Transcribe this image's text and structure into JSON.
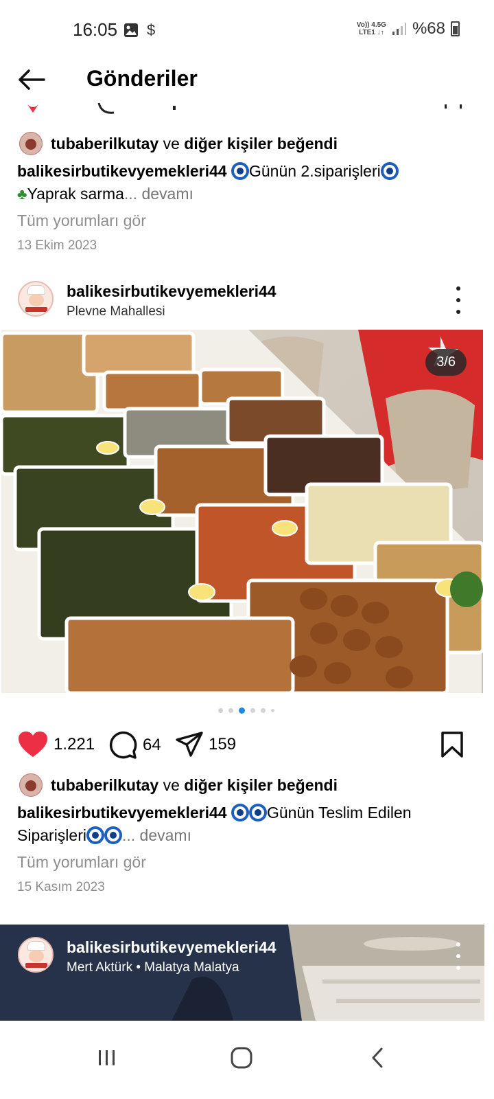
{
  "status": {
    "time": "16:05",
    "left_icons": [
      "image-icon",
      "dollar-icon"
    ],
    "net_top": "Vo)) 4.5G",
    "net_bottom": "LTE1 ↓↑",
    "battery": "%68"
  },
  "header": {
    "title": "Gönderiler",
    "back_icon": "arrow-left-icon"
  },
  "previous_post": {
    "liked_user": "tubaberilkutay",
    "liked_connector": "ve",
    "liked_others": "diğer kişiler beğendi",
    "caption_user": "balikesirbutikevyemekleri44",
    "caption_text": "Günün 2.siparişleri",
    "caption_line2": "Yaprak sarma",
    "more_label": "... devamı",
    "comments_link": "Tüm yorumları gör",
    "date": "13 Ekim 2023"
  },
  "post": {
    "username": "balikesirbutikevyemekleri44",
    "location": "Plevne Mahallesi",
    "counter": "3/6",
    "carousel": {
      "total": 6,
      "active": 3
    },
    "likes": "1.221",
    "comments": "64",
    "shares": "159",
    "liked_user": "tubaberilkutay",
    "liked_connector": "ve",
    "liked_others": "diğer kişiler beğendi",
    "caption_user": "balikesirbutikevyemekleri44",
    "caption_text": "Günün Teslim Edilen",
    "caption_line2": "Siparişleri",
    "more_label": "... devamı",
    "comments_link": "Tüm yorumları gör",
    "date": "15 Kasım 2023"
  },
  "next_post": {
    "username": "balikesirbutikevyemekleri44",
    "location": "Mert Aktürk • Malatya Malatya"
  },
  "nav": [
    "recent-apps-icon",
    "home-icon",
    "back-icon"
  ],
  "colors": {
    "like_red": "#ed2f46",
    "carousel_active": "#1e88e5",
    "muted_gray": "#8e8e8e"
  }
}
